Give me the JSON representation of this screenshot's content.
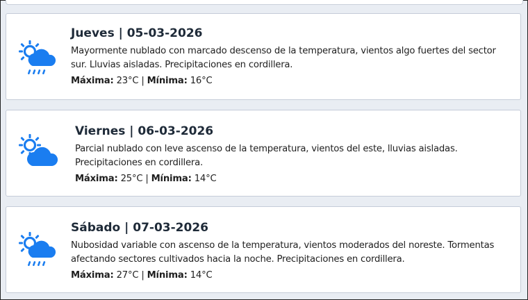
{
  "forecast": [
    {
      "day": "Jueves | 05-03-2026",
      "icon": "sun-cloud-rain-icon",
      "description": "Mayormente nublado con marcado descenso de la temperatura, vientos algo fuertes del sector sur. Lluvias aisladas. Precipitaciones en cordillera.",
      "max_label": "Máxima:",
      "max_value": "23°C",
      "separator": "|",
      "min_label": "Mínima:",
      "min_value": "16°C"
    },
    {
      "day": "Viernes | 06-03-2026",
      "icon": "sun-cloud-icon",
      "description": "Parcial nublado con leve ascenso de la temperatura, vientos del este, lluvias aisladas. Precipitaciones en cordillera.",
      "max_label": "Máxima:",
      "max_value": "25°C",
      "separator": "|",
      "min_label": "Mínima:",
      "min_value": "14°C"
    },
    {
      "day": "Sábado | 07-03-2026",
      "icon": "sun-cloud-rain-icon",
      "description": "Nubosidad variable con ascenso de la temperatura, vientos moderados del noreste. Tormentas afectando sectores cultivados hacia la noche. Precipitaciones en cordillera.",
      "max_label": "Máxima:",
      "max_value": "27°C",
      "separator": "|",
      "min_label": "Mínima:",
      "min_value": "14°C"
    }
  ],
  "colors": {
    "icon_blue": "#1a7df0",
    "title": "#1e2a38",
    "text": "#1f1f1f"
  }
}
